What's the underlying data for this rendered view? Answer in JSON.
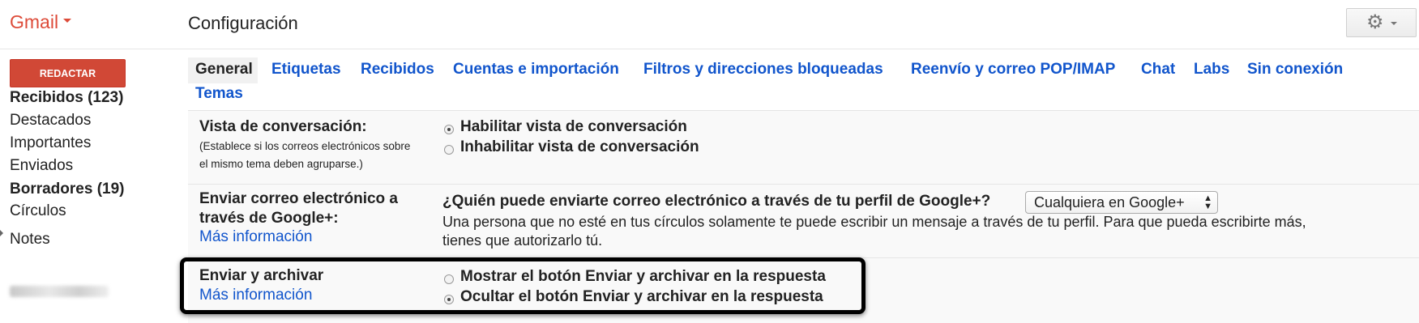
{
  "header": {
    "brand": "Gmail",
    "page_title": "Configuración",
    "settings_icon": "gear-icon"
  },
  "sidebar": {
    "compose_label": "REDACTAR",
    "items": [
      {
        "label": "Recibidos (123)",
        "bold": true
      },
      {
        "label": "Destacados",
        "bold": false
      },
      {
        "label": "Importantes",
        "bold": false
      },
      {
        "label": "Enviados",
        "bold": false
      },
      {
        "label": "Borradores (19)",
        "bold": true
      },
      {
        "label": "Círculos",
        "bold": false
      },
      {
        "label": "Notes",
        "bold": false
      }
    ]
  },
  "tabs": [
    {
      "label": "General",
      "active": true
    },
    {
      "label": "Etiquetas",
      "active": false
    },
    {
      "label": "Recibidos",
      "active": false
    },
    {
      "label": "Cuentas e importación",
      "active": false
    },
    {
      "label": "Filtros y direcciones bloqueadas",
      "active": false
    },
    {
      "label": "Reenvío y correo POP/IMAP",
      "active": false
    },
    {
      "label": "Chat",
      "active": false
    },
    {
      "label": "Labs",
      "active": false
    },
    {
      "label": "Sin conexión",
      "active": false
    },
    {
      "label": "Temas",
      "active": false
    }
  ],
  "settings": {
    "conversation_view": {
      "label": "Vista de conversación:",
      "help_line1": "(Establece si los correos electrónicos sobre",
      "help_line2": "el mismo tema deben agruparse.)",
      "options": [
        {
          "label": "Habilitar vista de conversación",
          "selected": true
        },
        {
          "label": "Inhabilitar vista de conversación",
          "selected": false
        }
      ]
    },
    "google_plus": {
      "label_line1": "Enviar correo electrónico a",
      "label_line2": "través de Google+:",
      "more_info": "Más información",
      "question": "¿Quién puede enviarte correo electrónico a través de tu perfil de Google+?",
      "selected_value": "Cualquiera en Google+",
      "description_line1": "Una persona que no esté en tus círculos solamente te puede escribir un mensaje a través de tu perfil. Para que pueda escribirte más,",
      "description_line2": "tienes que autorizarlo tú."
    },
    "send_and_archive": {
      "label": "Enviar y archivar",
      "more_info": "Más información",
      "options": [
        {
          "label": "Mostrar el botón Enviar y archivar en la respuesta",
          "selected": false
        },
        {
          "label": "Ocultar el botón Enviar y archivar en la respuesta",
          "selected": true
        }
      ]
    }
  },
  "colors": {
    "brand_red": "#dd4b39",
    "compose_red": "#d14836",
    "link_blue": "#1155cc"
  }
}
